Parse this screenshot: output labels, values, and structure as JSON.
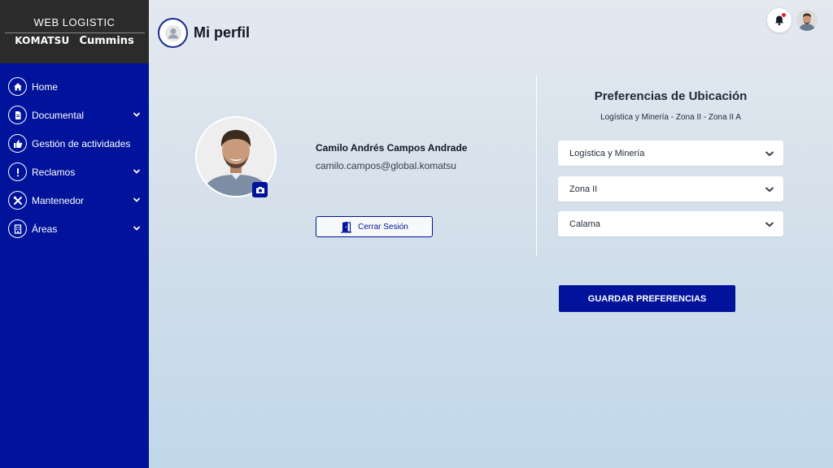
{
  "brand": {
    "title": "WEB LOGISTIC",
    "logo_left": "KOMATSU",
    "logo_right": "Cummins"
  },
  "sidebar": {
    "items": [
      {
        "label": "Home",
        "icon": "home-icon",
        "has_chevron": false
      },
      {
        "label": "Documental",
        "icon": "document-icon",
        "has_chevron": true
      },
      {
        "label": "Gestión de actividades",
        "icon": "thumbs-up-icon",
        "has_chevron": false
      },
      {
        "label": "Reclamos",
        "icon": "exclamation-icon",
        "has_chevron": true
      },
      {
        "label": "Mantenedor",
        "icon": "tools-icon",
        "has_chevron": true
      },
      {
        "label": "Áreas",
        "icon": "building-icon",
        "has_chevron": true
      }
    ]
  },
  "header": {
    "title": "Mi perfil"
  },
  "profile": {
    "name": "Camilo Andrés Campos Andrade",
    "email": "camilo.campos@global.komatsu",
    "logout_label": "Cerrar Sesión"
  },
  "preferences": {
    "title": "Preferencias de Ubicación",
    "subtitle": "Logística y Minería - Zona II - Zona II A",
    "selects": [
      {
        "value": "Logística y Minería"
      },
      {
        "value": "Zona II"
      },
      {
        "value": "Calama"
      }
    ],
    "save_label": "GUARDAR PREFERENCIAS"
  },
  "colors": {
    "sidebar_bg": "#00139a",
    "brand_bg": "#2b2b2b",
    "accent": "#00139a",
    "notification_dot": "#e02424"
  }
}
